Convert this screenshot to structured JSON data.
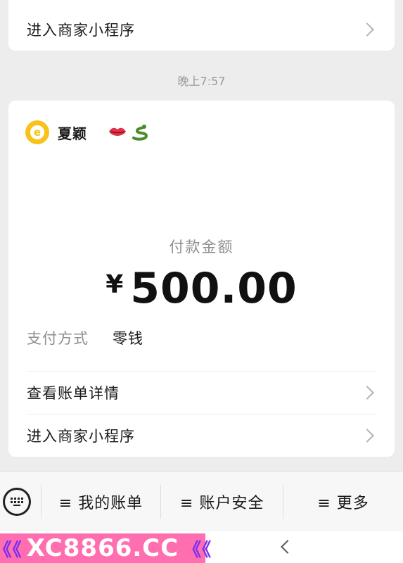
{
  "top_card": {
    "row_label": "进入商家小程序"
  },
  "timestamp": "晚上7:57",
  "payment": {
    "merchant_name": "夏颖",
    "emojis": [
      "lips-icon",
      "snake-icon"
    ],
    "amount_label": "付款金额",
    "currency_symbol": "¥",
    "amount": "500.00",
    "method_key": "支付方式",
    "method_value": "零钱",
    "rows": [
      {
        "label": "查看账单详情"
      },
      {
        "label": "进入商家小程序"
      }
    ]
  },
  "bottom_menu": {
    "items": [
      "≡ 我的账单",
      "≡ 账户安全",
      "≡ 更多"
    ]
  },
  "watermark": {
    "text": "XC8866.CC",
    "left_arrows": "《《",
    "right_arrows": "《《"
  },
  "colors": {
    "logo": "#f7c21a",
    "watermark_bg": "#ff6fb0",
    "watermark_arrows": "#7a2ff0"
  }
}
